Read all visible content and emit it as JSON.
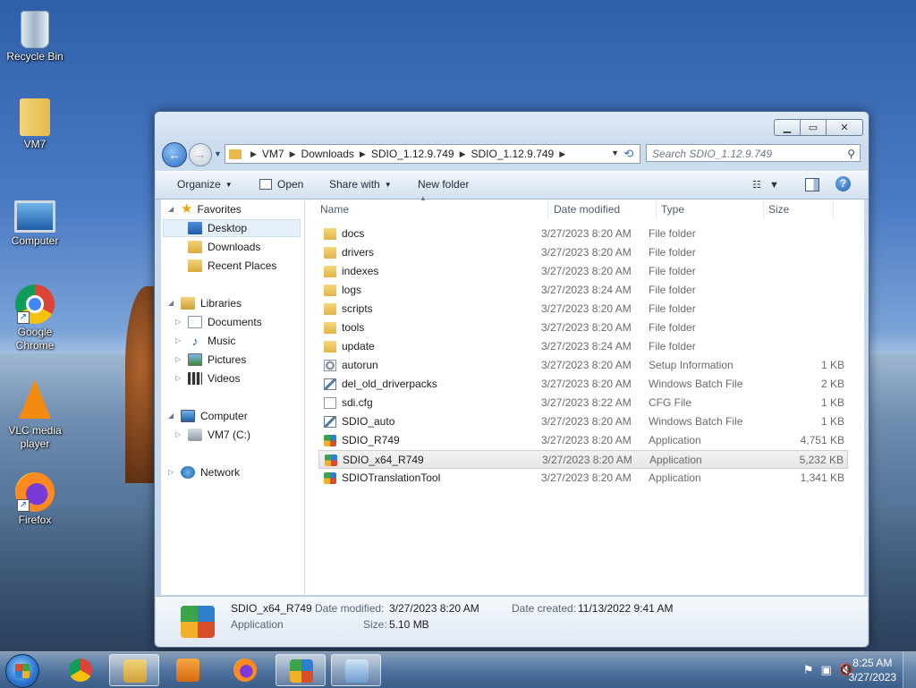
{
  "desktop": {
    "icons": [
      {
        "label": "Recycle Bin"
      },
      {
        "label": "VM7"
      },
      {
        "label": "Computer"
      },
      {
        "label": "Google Chrome"
      },
      {
        "label": "VLC media player"
      },
      {
        "label": "Firefox"
      }
    ]
  },
  "window": {
    "address": {
      "crumbs": [
        "VM7",
        "Downloads",
        "SDIO_1.12.9.749",
        "SDIO_1.12.9.749"
      ]
    },
    "search_placeholder": "Search SDIO_1.12.9.749",
    "toolbar": {
      "organize": "Organize",
      "open": "Open",
      "share_with": "Share with",
      "new_folder": "New folder"
    },
    "nav": {
      "favorites": "Favorites",
      "desktop": "Desktop",
      "downloads": "Downloads",
      "recent_places": "Recent Places",
      "libraries": "Libraries",
      "documents": "Documents",
      "music": "Music",
      "pictures": "Pictures",
      "videos": "Videos",
      "computer": "Computer",
      "drive": "VM7 (C:)",
      "network": "Network"
    },
    "columns": {
      "name": "Name",
      "date": "Date modified",
      "type": "Type",
      "size": "Size"
    },
    "files": [
      {
        "name": "docs",
        "date": "3/27/2023 8:20 AM",
        "type": "File folder",
        "size": "",
        "icon": "folder-icon"
      },
      {
        "name": "drivers",
        "date": "3/27/2023 8:20 AM",
        "type": "File folder",
        "size": "",
        "icon": "folder-icon"
      },
      {
        "name": "indexes",
        "date": "3/27/2023 8:20 AM",
        "type": "File folder",
        "size": "",
        "icon": "folder-icon"
      },
      {
        "name": "logs",
        "date": "3/27/2023 8:24 AM",
        "type": "File folder",
        "size": "",
        "icon": "folder-icon"
      },
      {
        "name": "scripts",
        "date": "3/27/2023 8:20 AM",
        "type": "File folder",
        "size": "",
        "icon": "folder-icon"
      },
      {
        "name": "tools",
        "date": "3/27/2023 8:20 AM",
        "type": "File folder",
        "size": "",
        "icon": "folder-icon"
      },
      {
        "name": "update",
        "date": "3/27/2023 8:24 AM",
        "type": "File folder",
        "size": "",
        "icon": "folder-icon"
      },
      {
        "name": "autorun",
        "date": "3/27/2023 8:20 AM",
        "type": "Setup Information",
        "size": "1 KB",
        "icon": "setup-info-icon"
      },
      {
        "name": "del_old_driverpacks",
        "date": "3/27/2023 8:20 AM",
        "type": "Windows Batch File",
        "size": "2 KB",
        "icon": "batch-file-icon"
      },
      {
        "name": "sdi.cfg",
        "date": "3/27/2023 8:22 AM",
        "type": "CFG File",
        "size": "1 KB",
        "icon": "document-icon"
      },
      {
        "name": "SDIO_auto",
        "date": "3/27/2023 8:20 AM",
        "type": "Windows Batch File",
        "size": "1 KB",
        "icon": "batch-file-icon"
      },
      {
        "name": "SDIO_R749",
        "date": "3/27/2023 8:20 AM",
        "type": "Application",
        "size": "4,751 KB",
        "icon": "application-icon"
      },
      {
        "name": "SDIO_x64_R749",
        "date": "3/27/2023 8:20 AM",
        "type": "Application",
        "size": "5,232 KB",
        "icon": "application-icon"
      },
      {
        "name": "SDIOTranslationTool",
        "date": "3/27/2023 8:20 AM",
        "type": "Application",
        "size": "1,341 KB",
        "icon": "application-icon"
      }
    ],
    "details": {
      "name": "SDIO_x64_R749",
      "type": "Application",
      "date_modified_label": "Date modified:",
      "date_modified": "3/27/2023 8:20 AM",
      "size_label": "Size:",
      "size": "5.10 MB",
      "date_created_label": "Date created:",
      "date_created": "11/13/2022 9:41 AM"
    }
  },
  "taskbar": {
    "clock_time": "8:25 AM",
    "clock_date": "3/27/2023"
  }
}
